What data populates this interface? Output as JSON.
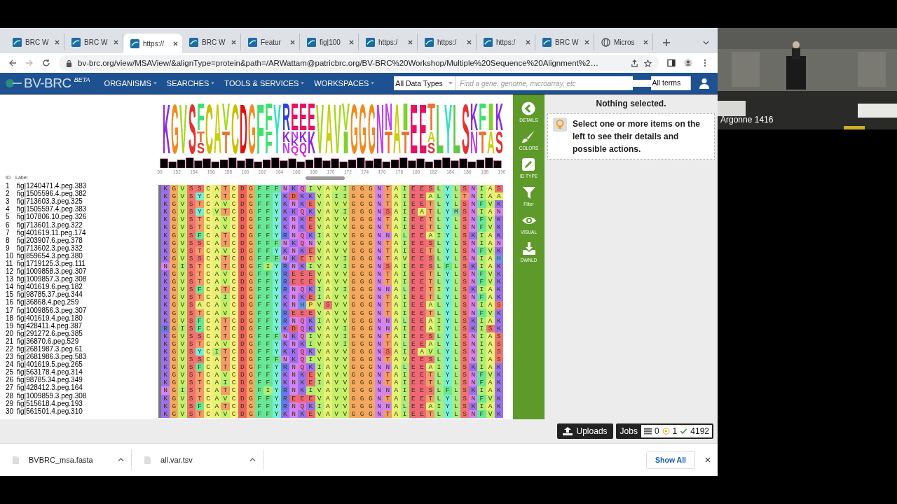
{
  "tabs": [
    {
      "title": "BRC W",
      "kind": "site",
      "selected": false
    },
    {
      "title": "BRC W",
      "kind": "site",
      "selected": false
    },
    {
      "title": "https://",
      "kind": "site",
      "selected": true
    },
    {
      "title": "BRC W",
      "kind": "site",
      "selected": false
    },
    {
      "title": "Featur",
      "kind": "site",
      "selected": false
    },
    {
      "title": "fig|100",
      "kind": "site",
      "selected": false
    },
    {
      "title": "https:/",
      "kind": "site",
      "selected": false
    },
    {
      "title": "https:/",
      "kind": "site",
      "selected": false
    },
    {
      "title": "https:/",
      "kind": "site",
      "selected": false
    },
    {
      "title": "BRC W",
      "kind": "site",
      "selected": false
    },
    {
      "title": "Micros",
      "kind": "globe",
      "selected": false
    }
  ],
  "address": {
    "url": "bv-brc.org/view/MSAView/&alignType=protein&path=/ARWattam@patricbrc.org/BV-BRC%20Workshop/Multiple%20Sequence%20Alignment%2…"
  },
  "navbar": {
    "logo": "BV-BRC",
    "badge": "BETA",
    "menus": [
      "ORGANISMS",
      "SEARCHES",
      "TOOLS & SERVICES",
      "WORKSPACES"
    ],
    "search": {
      "scope": "All Data Types",
      "placeholder": "Find a gene, genome, microarray, etc",
      "mode": "All terms"
    }
  },
  "alignment": {
    "header": {
      "id": "ID",
      "label": "Label"
    },
    "logo": [
      "K",
      "G",
      "V",
      "S",
      "FTS",
      "C",
      "A",
      "VT",
      "C",
      "D",
      "G",
      "F",
      "FF",
      "Y",
      "RKN",
      "ENKQ",
      "EKQ",
      "EK",
      "V",
      "A",
      "V",
      "VI",
      "G",
      "G",
      "G",
      "N",
      "NT",
      "A",
      "IT",
      "E",
      "E",
      "TAS",
      "L",
      "Y",
      "L",
      "S",
      "KN",
      "FT",
      "IA",
      "KS"
    ],
    "ruler": [
      "50",
      "152",
      "154",
      "156",
      "158",
      "160",
      "162",
      "164",
      "166",
      "168",
      "170",
      "172",
      "174",
      "176",
      "178",
      "180",
      "182",
      "184",
      "186",
      "188",
      "190"
    ],
    "rows": [
      {
        "id": "1",
        "label": "fig|1240471.4.peg.383",
        "sequence": "KGVSSCATCDGFFFNKQIVAVIGGGNTAIEESLYLSNIAS"
      },
      {
        "id": "2",
        "label": "fig|1505596.4.peg.382",
        "sequence": "KGVSYCATCDGFFYKDKKVAIIGGGNTAIEEALYLTNIAA"
      },
      {
        "id": "3",
        "label": "fig|713603.3.peg.325",
        "sequence": "KGVSTCAVCDGFFYKNKEVAVVGGGNTAIEETLYLSNFVK"
      },
      {
        "id": "4",
        "label": "fig|1505597.4.peg.383",
        "sequence": "KGVSYCVTCDGFFYKKQKVAVIGGGNSAIEATLYMSNIAN"
      },
      {
        "id": "5",
        "label": "fig|107806.10.peg.326",
        "sequence": "KGVSTCAVCDGFFYKNKEVAVVGGGNTAIEETLYLSNFVK"
      },
      {
        "id": "6",
        "label": "fig|713601.3.peg.322",
        "sequence": "KGVSTCAVCDGFFYKNKEVAVVGGGNTAIEETLYLSNFVK"
      },
      {
        "id": "7",
        "label": "fig|401619.11.peg.174",
        "sequence": "KGVSFCATCDGFFYRNQKIAVVGGGNNALEEAIYLSKIAK"
      },
      {
        "id": "8",
        "label": "fig|203907.6.peg.378",
        "sequence": "KGVSSCATCDGFFFNKQNVAVVGGGNTAIEESLYLSNIAN"
      },
      {
        "id": "9",
        "label": "fig|713602.3.peg.332",
        "sequence": "KGVSTCAVCDGFFYKNKEVAVVGGGNTAIEETLYLSNFVK"
      },
      {
        "id": "10",
        "label": "fig|859654.3.peg.380",
        "sequence": "KGVSSCATCDGFFFNKETVAVIGGGNTAVEESLYLSNIAH"
      },
      {
        "id": "11",
        "label": "fig|1719125.3.peg.111",
        "sequence": "NGISTCATCDGFIYRNKIVAVIGGGNSAIEESLFLSKIAK"
      },
      {
        "id": "12",
        "label": "fig|1009858.3.peg.307",
        "sequence": "KGVSTCAVCDGFFYREEEVAVVGGGNTAIEETLYLSNFVK"
      },
      {
        "id": "13",
        "label": "fig|1009857.3.peg.308",
        "sequence": "KGVSTCAVCDGFFYREEEVAVVGGGNTAIEETLYLSNFVK"
      },
      {
        "id": "14",
        "label": "fig|401619.6.peg.182",
        "sequence": "KGVSFCATCDGFFYRNQKIAVIGGGNNALEETIYLSKIAK"
      },
      {
        "id": "15",
        "label": "fig|98785.37.peg.344",
        "sequence": "KGVSTCAICDGFFYKNKEIAVVGGGNTAIEETLYLSNFAK"
      },
      {
        "id": "16",
        "label": "fig|36868.4.peg.259",
        "sequence": "KGVSACAVCDGFFYKNHPVSVVGGGNTAIEEALYLSNIAS"
      },
      {
        "id": "17",
        "label": "fig|1009856.3.peg.307",
        "sequence": "KGVSTCAVCDGFFYREEEVAVVGGGNTAIEETLYLSNFVK"
      },
      {
        "id": "18",
        "label": "fig|401619.4.peg.180",
        "sequence": "KGVSFCATCDGFFYRNQKIAVVGGGNNALEEAIYLSKIAK"
      },
      {
        "id": "19",
        "label": "fig|428411.4.peg.387",
        "sequence": "RGISFCATCDGFFYKDQKVAVIGGGNNAIEEAIYLSKISK"
      },
      {
        "id": "20",
        "label": "fig|291272.6.peg.385",
        "sequence": "KGVSSCATCDGFFFNKQIVAVIGGGNTAIEESLYLSNIAS"
      },
      {
        "id": "21",
        "label": "fig|36870.6.peg.529",
        "sequence": "KGVSTCAVCDGFFYKNKIVAVIGGGNTALEEALYLSNIAS"
      },
      {
        "id": "22",
        "label": "fig|2681987.3.peg.61",
        "sequence": "KGVSYCITCDGFFYKKQKVAVVGGGNSAIEAVLYLSNIAS"
      },
      {
        "id": "23",
        "label": "fig|2681986.3.peg.583",
        "sequence": "KGVSSCATCDGFFFNKQIVAVVGGGNTAVEESLYLSNIAS"
      },
      {
        "id": "24",
        "label": "fig|401619.5.peg.265",
        "sequence": "KGVSFCATCDGFFYRNQKIAVVGGGNNALEEAIYLSKIAK"
      },
      {
        "id": "25",
        "label": "fig|563178.4.peg.314",
        "sequence": "KGVSTCAVCDGFFYKNKEVAVVGGGNTAIEETLYLSNFVK"
      },
      {
        "id": "26",
        "label": "fig|98785.34.peg.349",
        "sequence": "KGVSTCAICDGFFYKNKEIAVVGGGNTAIEETLYLSNFAK"
      },
      {
        "id": "27",
        "label": "fig|428412.3.peg.164",
        "sequence": "NGISTCATCDGFIYRNKIVAVVGGGNNAIEESLFLSKIAK"
      },
      {
        "id": "28",
        "label": "fig|1009859.3.peg.308",
        "sequence": "KGVSTCAVCDGFFYREEEVAVVGGGNTAIEETLYLSNFVK"
      },
      {
        "id": "29",
        "label": "fig|515618.4.peg.193",
        "sequence": "KGVSFCATCDGFFYRNQKIAVVGGGNNALEEAIYLSKIAK"
      },
      {
        "id": "30",
        "label": "fig|561501.4.peg.310",
        "sequence": "KGVSTCAVCDGFFYKNKEVAVVGGGNTAIEETLYLSNFVK"
      }
    ]
  },
  "sidebar": [
    {
      "label": "DETAILS",
      "kind": "back"
    },
    {
      "label": "COLORS",
      "kind": "brush"
    },
    {
      "label": "ID TYPE",
      "kind": "pencil"
    },
    {
      "label": "Filter",
      "kind": "filter"
    },
    {
      "label": "VISUAL",
      "kind": "eye"
    },
    {
      "label": "DWNLD",
      "kind": "download"
    }
  ],
  "details": {
    "title": "Nothing selected.",
    "message": "Select one or more items on the left to see their details and possible actions."
  },
  "status": {
    "uploads": "Uploads",
    "jobs": "Jobs",
    "queued": "0",
    "running": "1",
    "done": "4192"
  },
  "downloads": {
    "files": [
      "BVBRC_msa.fasta",
      "all.var.tsv"
    ],
    "show_all": "Show All"
  },
  "video": {
    "caption": "Argonne 1416"
  }
}
